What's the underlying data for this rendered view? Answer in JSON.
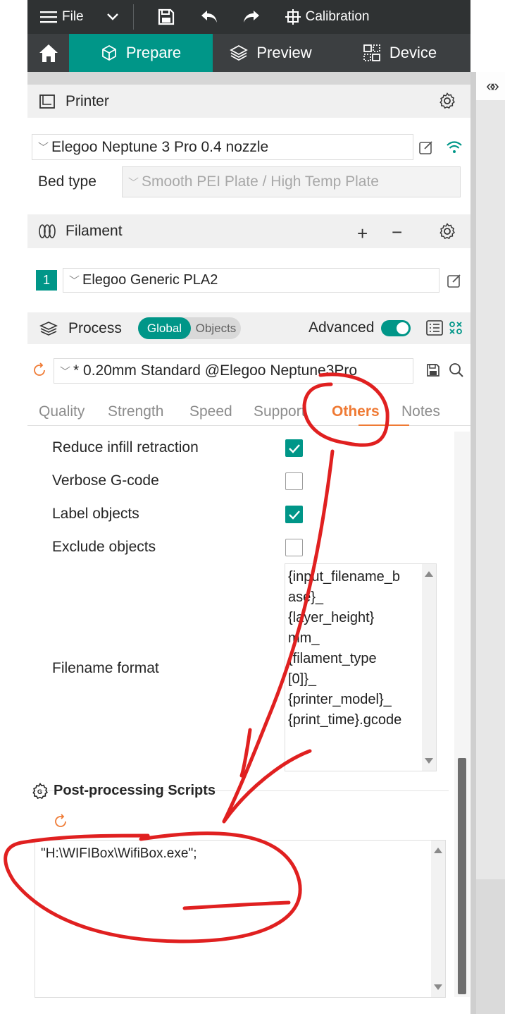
{
  "menubar": {
    "file_label": "File",
    "calibration_label": "Calibration"
  },
  "tabs": {
    "prepare": "Prepare",
    "preview": "Preview",
    "device": "Device"
  },
  "printer": {
    "title": "Printer",
    "selected": "Elegoo Neptune 3 Pro 0.4 nozzle",
    "bed_type_label": "Bed type",
    "bed_type_value": "Smooth PEI Plate / High Temp Plate"
  },
  "filament": {
    "title": "Filament",
    "slot_number": "1",
    "selected": "Elegoo Generic PLA2"
  },
  "process": {
    "title": "Process",
    "global_label": "Global",
    "objects_label": "Objects",
    "advanced_label": "Advanced",
    "advanced_on": true,
    "preset": "* 0.20mm Standard @Elegoo Neptune3Pro"
  },
  "subtabs": [
    "Quality",
    "Strength",
    "Speed",
    "Support",
    "Others",
    "Notes"
  ],
  "active_subtab": "Others",
  "settings": [
    {
      "label": "Reduce infill retraction",
      "checked": true
    },
    {
      "label": "Verbose G-code",
      "checked": false
    },
    {
      "label": "Label objects",
      "checked": true
    },
    {
      "label": "Exclude objects",
      "checked": false
    }
  ],
  "filename_format": {
    "label": "Filename format",
    "lines": [
      "{input_filename_b",
      "ase}_",
      "{layer_height}",
      "mm_",
      "{filament_type",
      "[0]}_",
      "{printer_model}_",
      "{print_time}.gcode"
    ]
  },
  "post_processing": {
    "title": "Post-processing Scripts",
    "value": "\"H:\\WIFIBox\\WifiBox.exe\";"
  },
  "colors": {
    "accent": "#009688",
    "active_tab": "#ef7a34",
    "annotation": "#e02020",
    "menubar": "#2f3233"
  }
}
